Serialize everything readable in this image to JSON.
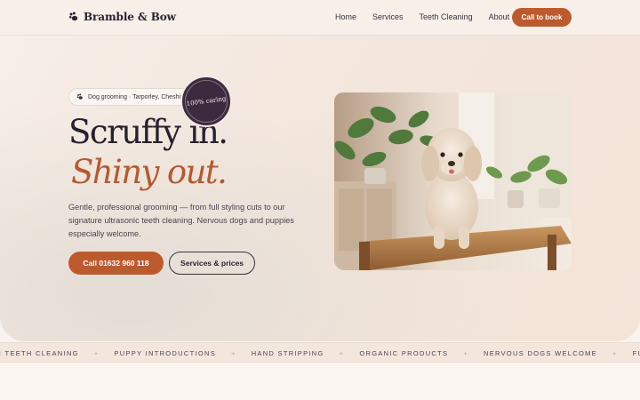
{
  "header": {
    "brand_name": "Bramble & Bow",
    "brand_icon": "paw-icon",
    "nav": [
      "Home",
      "Services",
      "Teeth Cleaning",
      "About"
    ],
    "cta_label": "Call to book"
  },
  "hero": {
    "location_pill": "Dog grooming · Tarporley, Cheshire",
    "headline_line1": "Scruffy in.",
    "headline_line2": "Shiny out.",
    "description": "Gentle, professional grooming — from full styling cuts to our signature ultrasonic teeth cleaning. Nervous dogs and puppies especially welcome.",
    "call_button": "Call  01632 960 118",
    "services_button": "Services & prices",
    "badge_text": "100% caring",
    "photo_alt": "Cream cockapoo sitting on a wooden table"
  },
  "ticker": {
    "items": [
      "RASONIC TEETH CLEANING",
      "PUPPY INTRODUCTIONS",
      "HAND STRIPPING",
      "ORGANIC PRODUCTS",
      "NERVOUS DOGS WELCOME",
      "FULL GROOM"
    ],
    "separator": "+"
  },
  "colors": {
    "accent": "#bd5a2d",
    "ink": "#2a2230",
    "badge": "#3c2a3e",
    "background": "#f8f3ee"
  }
}
